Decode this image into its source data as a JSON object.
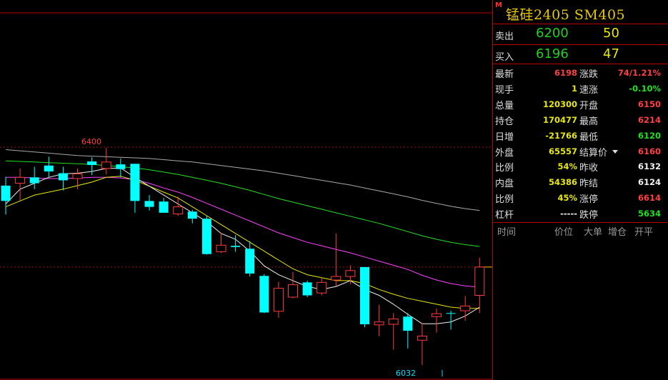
{
  "chart_data": {
    "type": "candlestick",
    "high_label": "6400",
    "low_label": "6032",
    "current_price_line": 6198,
    "colors": {
      "up": "#ff3b3b",
      "down": "#00ffff",
      "ma5": "#f0f0f0",
      "ma10": "#e8e800",
      "ma20": "#ff40ff",
      "ma40": "#20e020",
      "ma60": "#a8a8a8"
    },
    "candles": [
      {
        "o": 6336,
        "h": 6351,
        "l": 6287,
        "c": 6310
      },
      {
        "o": 6340,
        "h": 6365,
        "l": 6311,
        "c": 6350
      },
      {
        "o": 6350,
        "h": 6368,
        "l": 6330,
        "c": 6340
      },
      {
        "o": 6370,
        "h": 6385,
        "l": 6350,
        "c": 6360
      },
      {
        "o": 6357,
        "h": 6368,
        "l": 6328,
        "c": 6345
      },
      {
        "o": 6348,
        "h": 6365,
        "l": 6330,
        "c": 6356
      },
      {
        "o": 6377,
        "h": 6384,
        "l": 6354,
        "c": 6371
      },
      {
        "o": 6365,
        "h": 6400,
        "l": 6355,
        "c": 6376
      },
      {
        "o": 6372,
        "h": 6382,
        "l": 6350,
        "c": 6364
      },
      {
        "o": 6373,
        "h": 6373,
        "l": 6290,
        "c": 6310
      },
      {
        "o": 6310,
        "h": 6320,
        "l": 6294,
        "c": 6300
      },
      {
        "o": 6309,
        "h": 6315,
        "l": 6290,
        "c": 6290
      },
      {
        "o": 6288,
        "h": 6318,
        "l": 6285,
        "c": 6300
      },
      {
        "o": 6292,
        "h": 6295,
        "l": 6272,
        "c": 6280
      },
      {
        "o": 6280,
        "h": 6285,
        "l": 6219,
        "c": 6220
      },
      {
        "o": 6224,
        "h": 6256,
        "l": 6222,
        "c": 6235
      },
      {
        "o": 6234,
        "h": 6252,
        "l": 6224,
        "c": 6232
      },
      {
        "o": 6229,
        "h": 6242,
        "l": 6182,
        "c": 6187
      },
      {
        "o": 6183,
        "h": 6186,
        "l": 6120,
        "c": 6121
      },
      {
        "o": 6123,
        "h": 6173,
        "l": 6112,
        "c": 6162
      },
      {
        "o": 6147,
        "h": 6190,
        "l": 6145,
        "c": 6168
      },
      {
        "o": 6172,
        "h": 6175,
        "l": 6147,
        "c": 6150
      },
      {
        "o": 6154,
        "h": 6180,
        "l": 6150,
        "c": 6172
      },
      {
        "o": 6176,
        "h": 6255,
        "l": 6166,
        "c": 6182
      },
      {
        "o": 6182,
        "h": 6201,
        "l": 6169,
        "c": 6192
      },
      {
        "o": 6198,
        "h": 6198,
        "l": 6096,
        "c": 6101
      },
      {
        "o": 6100,
        "h": 6134,
        "l": 6081,
        "c": 6105
      },
      {
        "o": 6101,
        "h": 6120,
        "l": 6058,
        "c": 6110
      },
      {
        "o": 6114,
        "h": 6120,
        "l": 6060,
        "c": 6090
      },
      {
        "o": 6074,
        "h": 6103,
        "l": 6032,
        "c": 6081
      },
      {
        "o": 6114,
        "h": 6128,
        "l": 6087,
        "c": 6119
      },
      {
        "o": 6120,
        "h": 6124,
        "l": 6092,
        "c": 6119
      },
      {
        "o": 6124,
        "h": 6149,
        "l": 6107,
        "c": 6132
      },
      {
        "o": 6150,
        "h": 6214,
        "l": 6120,
        "c": 6198
      }
    ],
    "ma_lines": {
      "ma5": [
        6305,
        6330,
        6340,
        6350,
        6356,
        6357,
        6360,
        6365,
        6366,
        6350,
        6335,
        6320,
        6305,
        6290,
        6275,
        6255,
        6245,
        6225,
        6200,
        6185,
        6175,
        6165,
        6160,
        6165,
        6175,
        6160,
        6150,
        6135,
        6118,
        6102,
        6102,
        6105,
        6115,
        6130
      ],
      "ma10": [
        6300,
        6310,
        6320,
        6325,
        6330,
        6336,
        6342,
        6350,
        6352,
        6345,
        6335,
        6325,
        6315,
        6300,
        6285,
        6270,
        6255,
        6240,
        6225,
        6210,
        6195,
        6185,
        6180,
        6175,
        6175,
        6170,
        6160,
        6152,
        6145,
        6140,
        6135,
        6130,
        6128,
        6128
      ],
      "ma20": [
        6350,
        6350,
        6349,
        6348,
        6348,
        6349,
        6350,
        6350,
        6349,
        6346,
        6340,
        6332,
        6325,
        6316,
        6306,
        6296,
        6286,
        6276,
        6266,
        6256,
        6248,
        6240,
        6234,
        6228,
        6222,
        6215,
        6208,
        6201,
        6194,
        6184,
        6176,
        6170,
        6166,
        6164
      ],
      "ma40": [
        6378,
        6377,
        6376,
        6375,
        6374,
        6373,
        6372,
        6370,
        6368,
        6366,
        6363,
        6359,
        6355,
        6350,
        6345,
        6340,
        6334,
        6328,
        6321,
        6314,
        6308,
        6302,
        6296,
        6290,
        6284,
        6278,
        6272,
        6265,
        6258,
        6251,
        6245,
        6240,
        6236,
        6233
      ],
      "ma60": [
        6397,
        6395,
        6393,
        6391,
        6389,
        6387,
        6386,
        6385,
        6384,
        6383,
        6382,
        6380,
        6378,
        6376,
        6373,
        6370,
        6367,
        6364,
        6361,
        6357,
        6353,
        6349,
        6345,
        6341,
        6337,
        6332,
        6327,
        6322,
        6317,
        6311,
        6306,
        6301,
        6297,
        6294
      ]
    }
  },
  "panel": {
    "badge": "M",
    "title": "锰硅2405  SM405",
    "sell": {
      "label": "卖出",
      "price": "6200",
      "volume": "50"
    },
    "buy": {
      "label": "买入",
      "price": "6196",
      "volume": "47"
    },
    "rows": [
      {
        "l_label": "最新",
        "l_value": "6198",
        "l_color": "red",
        "r_label": "涨跌",
        "r_value": "74/1.21%",
        "r_color": "red"
      },
      {
        "l_label": "现手",
        "l_value": "1",
        "l_color": "yellow",
        "r_label": "速涨",
        "r_value": "-0.10%",
        "r_color": "green"
      },
      {
        "l_label": "总量",
        "l_value": "120300",
        "l_color": "yellow",
        "r_label": "开盘",
        "r_value": "6150",
        "r_color": "red"
      },
      {
        "l_label": "持仓",
        "l_value": "170477",
        "l_color": "yellow",
        "r_label": "最高",
        "r_value": "6214",
        "r_color": "red"
      },
      {
        "l_label": "日增",
        "l_value": "-21766",
        "l_color": "yellow",
        "r_label": "最低",
        "r_value": "6120",
        "r_color": "green"
      },
      {
        "l_label": "外盘",
        "l_value": "65557",
        "l_color": "yellow",
        "r_label": "结算价",
        "r_value": "6160",
        "r_color": "red"
      },
      {
        "l_label": "比例",
        "l_value": "54%",
        "l_color": "yellow",
        "r_label": "昨收",
        "r_value": "6132",
        "r_color": "white"
      },
      {
        "l_label": "内盘",
        "l_value": "54386",
        "l_color": "yellow",
        "r_label": "昨结",
        "r_value": "6124",
        "r_color": "white"
      },
      {
        "l_label": "比例",
        "l_value": "45%",
        "l_color": "yellow",
        "r_label": "涨停",
        "r_value": "6614",
        "r_color": "red"
      },
      {
        "l_label": "杠杆",
        "l_value": "-----",
        "l_color": "white",
        "r_label": "跌停",
        "r_value": "5634",
        "r_color": "green"
      }
    ],
    "tick_header": {
      "time": "时间",
      "price": "价位",
      "big": "大单",
      "oi": "增仓",
      "openclose": "开平"
    }
  }
}
